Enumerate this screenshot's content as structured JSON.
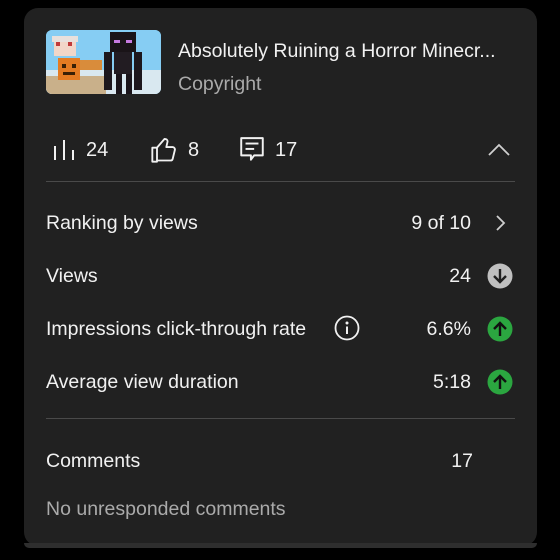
{
  "video": {
    "title": "Absolutely Ruining a Horror Minecr...",
    "visibility": "Copyright"
  },
  "stats": {
    "views": "24",
    "likes": "8",
    "comments": "17",
    "views_icon": "bar-chart-icon",
    "likes_icon": "thumbs-up-icon",
    "comments_icon": "comment-icon"
  },
  "metrics": [
    {
      "label": "Ranking by views",
      "value": "9 of 10",
      "indicator": "chevron-right-icon"
    },
    {
      "label": "Views",
      "value": "24",
      "indicator": "arrow-down-icon",
      "indicator_color": "#c0c0c0"
    },
    {
      "label": "Impressions click-through rate",
      "value": "6.6%",
      "indicator": "arrow-up-icon",
      "indicator_color": "#2ba640",
      "info_icon": "info-icon"
    },
    {
      "label": "Average view duration",
      "value": "5:18",
      "indicator": "arrow-up-icon",
      "indicator_color": "#2ba640"
    }
  ],
  "comments_section": {
    "label": "Comments",
    "count": "17",
    "status": "No unresponded comments"
  },
  "colors": {
    "card_bg": "#212121",
    "positive": "#2ba640",
    "neutral": "#c0c0c0",
    "text_primary": "#f1f1f1",
    "text_secondary": "#aaaaaa"
  }
}
